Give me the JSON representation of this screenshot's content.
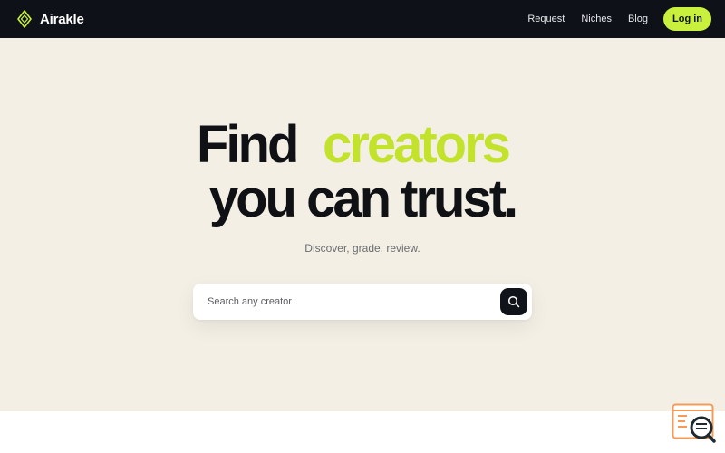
{
  "brand": {
    "name": "Airakle",
    "logo_icon": "diamond-logo-icon"
  },
  "nav": {
    "links": [
      "Request",
      "Niches",
      "Blog"
    ],
    "login_label": "Log in"
  },
  "hero": {
    "headline_word1": "Find",
    "headline_highlight": "creators",
    "headline_line2": "you can trust.",
    "subtitle": "Discover, grade, review."
  },
  "search": {
    "placeholder": "Search any creator",
    "button_icon": "search-icon"
  },
  "widget": {
    "icon": "chat-search-icon"
  },
  "colors": {
    "nav_bg": "#0e1218",
    "accent": "#c8f03c",
    "highlight": "#c3e22c",
    "hero_bg": "#f3efe5",
    "text_dark": "#0f1115"
  }
}
